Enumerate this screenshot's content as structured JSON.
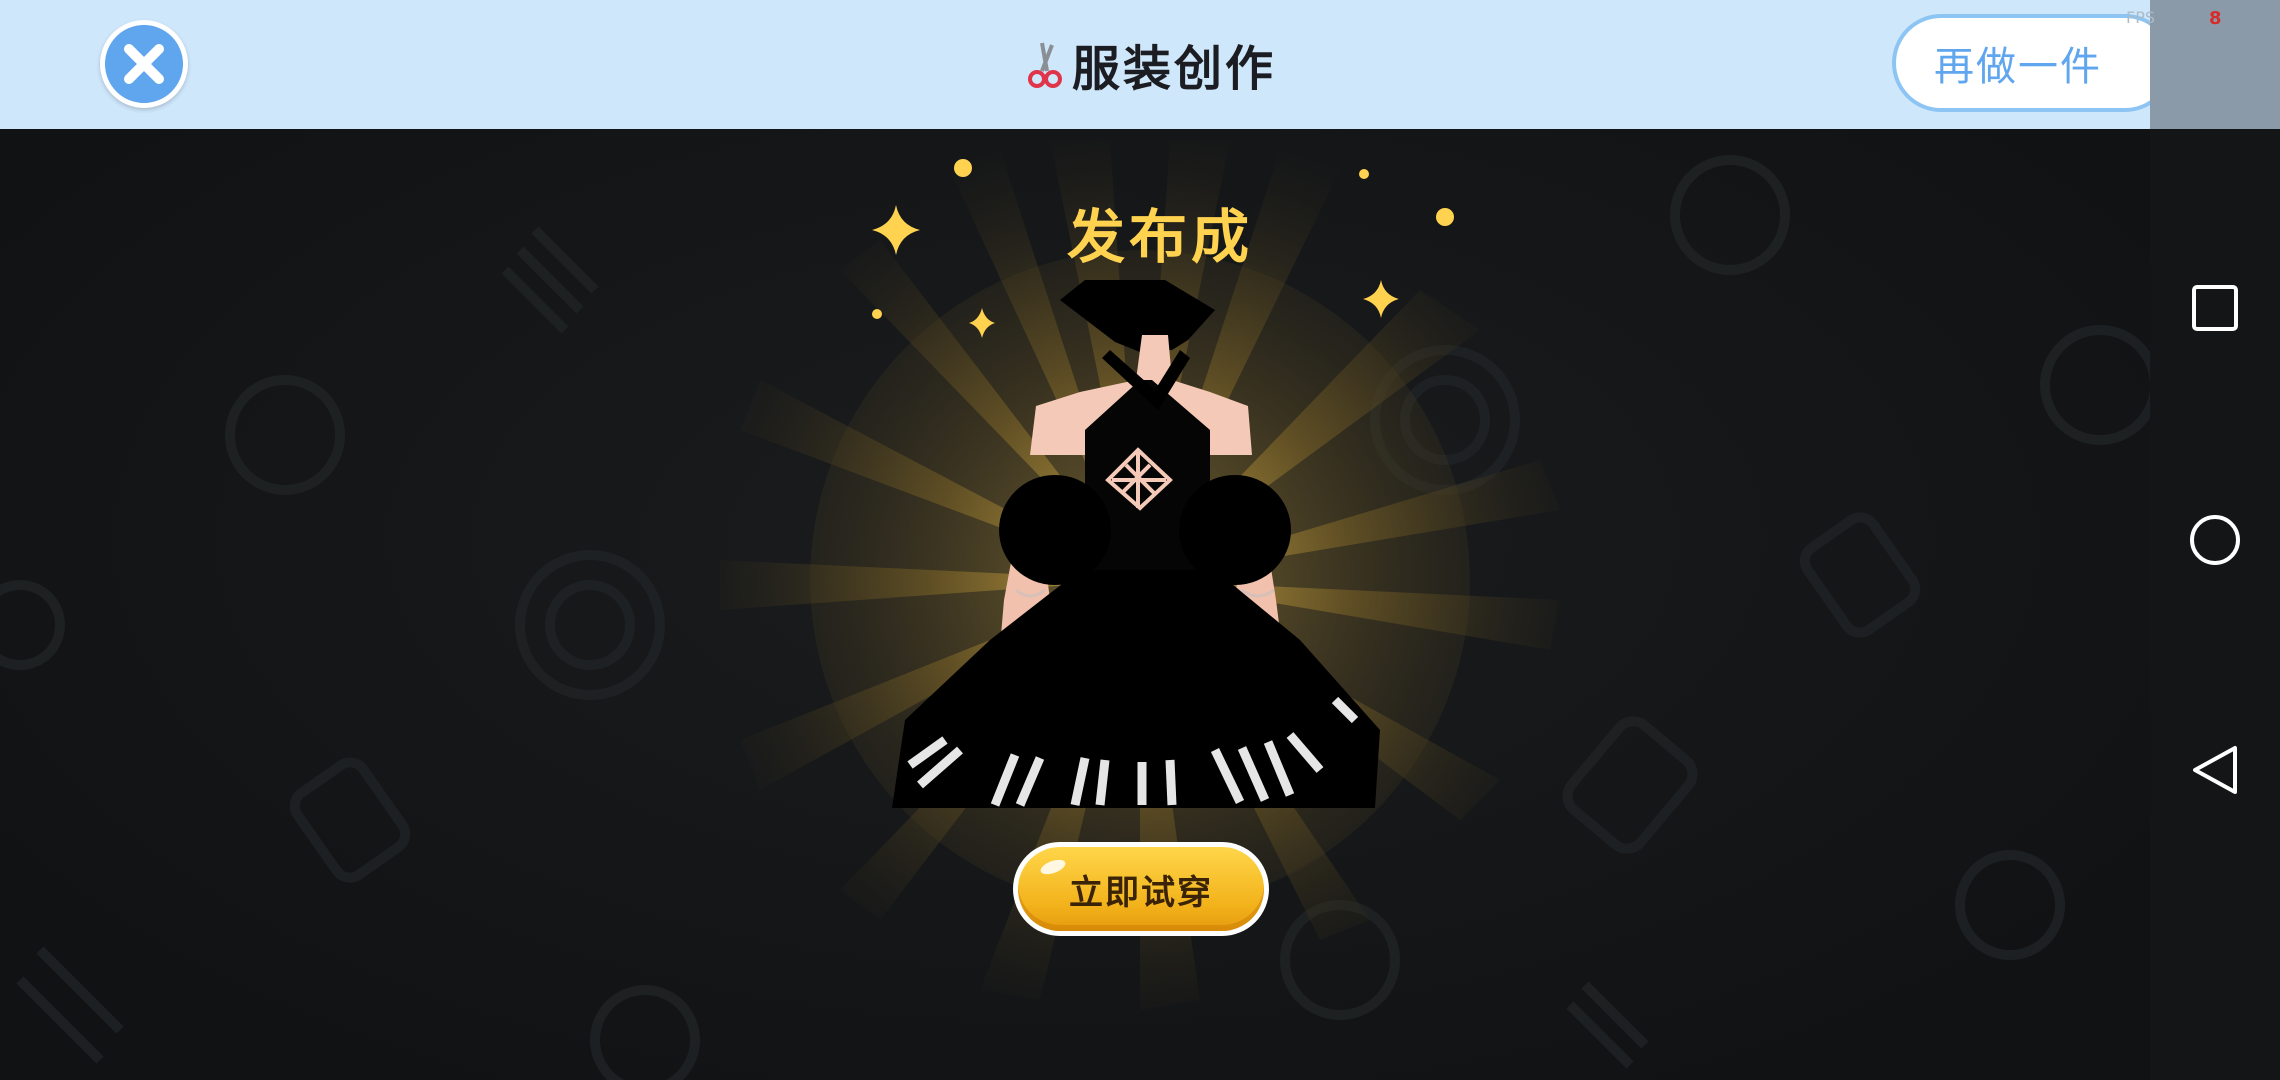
{
  "header": {
    "title": "服装创作",
    "title_icon": "scissors-icon",
    "close_icon": "close-icon",
    "redo_label": "再做一件",
    "background": "#cfe7fb",
    "accent": "#5fa6ee"
  },
  "status": {
    "fps_label": "FPS",
    "fps_value": "8"
  },
  "main": {
    "success_text": "发布成功",
    "success_color": "#ffd24f",
    "try_on_label": "立即试穿",
    "try_on_color": "#f4b91f"
  },
  "system_nav": {
    "buttons": [
      {
        "name": "recent-apps-button",
        "icon": "square-icon"
      },
      {
        "name": "home-button",
        "icon": "circle-icon"
      },
      {
        "name": "back-button",
        "icon": "triangle-back-icon"
      }
    ]
  }
}
